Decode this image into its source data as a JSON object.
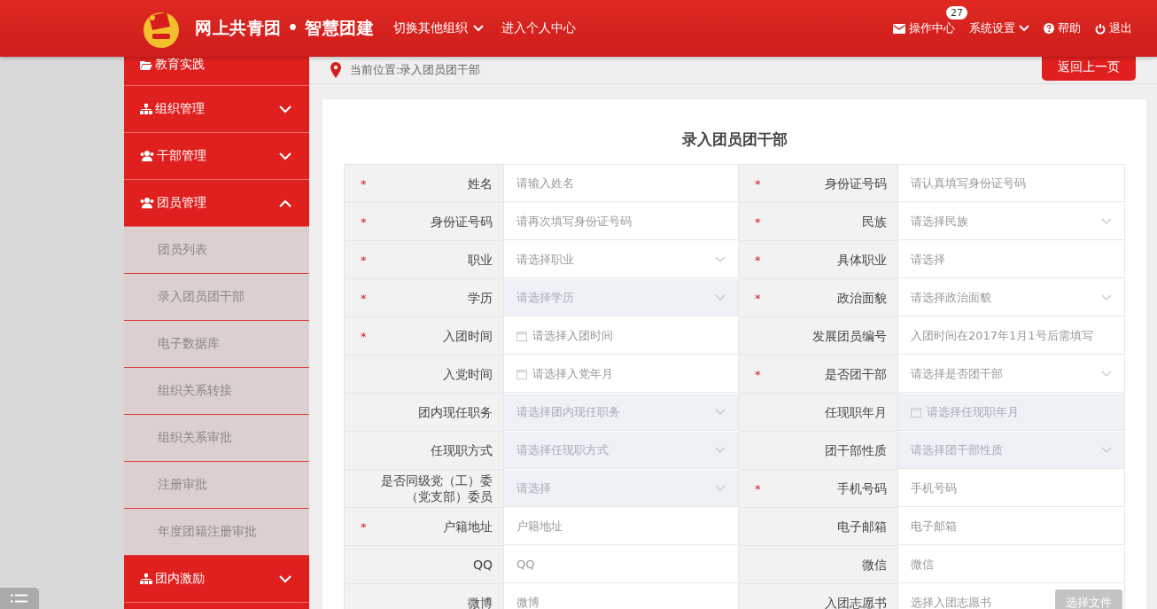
{
  "header": {
    "title": "网上共青团 • 智慧团建",
    "nav": [
      {
        "label": "切换其他组织",
        "dropdown": true
      },
      {
        "label": "进入个人中心",
        "dropdown": false
      }
    ],
    "actions": [
      {
        "kind": "mail",
        "label": "操作中心",
        "badge": "27",
        "dropdown": false
      },
      {
        "kind": "plain",
        "label": "系统设置",
        "dropdown": true
      },
      {
        "kind": "help",
        "label": "帮助",
        "dropdown": false
      },
      {
        "kind": "power",
        "label": "退出",
        "dropdown": false
      }
    ]
  },
  "sidebar": {
    "items": [
      {
        "label": "教育实践"
      },
      {
        "label": "组织管理",
        "expanded": false
      },
      {
        "label": "干部管理",
        "expanded": false
      },
      {
        "label": "团员管理",
        "expanded": true,
        "children": [
          {
            "label": "团员列表"
          },
          {
            "label": "录入团员团干部"
          },
          {
            "label": "电子数据库"
          },
          {
            "label": "组织关系转接"
          },
          {
            "label": "组织关系审批"
          },
          {
            "label": "注册审批"
          },
          {
            "label": "年度团籍注册审批"
          }
        ]
      },
      {
        "label": "团内激励",
        "expanded": false
      }
    ]
  },
  "breadcrumb": "当前位置:录入团员团干部",
  "back_button": "返回上一页",
  "form": {
    "title": "录入团员团干部",
    "rows": [
      [
        {
          "label": "姓名",
          "marker": "*",
          "kind": "text",
          "placeholder": "请输入姓名",
          "disabled": false
        },
        {
          "label": "身份证号码",
          "marker": "*",
          "kind": "text",
          "placeholder": "请认真填写身份证号码",
          "disabled": false
        }
      ],
      [
        {
          "label": "身份证号码",
          "marker": "*",
          "kind": "text",
          "placeholder": "请再次填写身份证号码",
          "disabled": false
        },
        {
          "label": "民族",
          "marker": "*",
          "kind": "select",
          "placeholder": "请选择民族",
          "disabled": false
        }
      ],
      [
        {
          "label": "职业",
          "marker": "*",
          "kind": "select",
          "placeholder": "请选择职业",
          "disabled": false
        },
        {
          "label": "具体职业",
          "marker": "*",
          "kind": "text",
          "placeholder": "请选择",
          "disabled": false
        }
      ],
      [
        {
          "label": "学历",
          "marker": "*",
          "kind": "select",
          "placeholder": "请选择学历",
          "disabled": true
        },
        {
          "label": "政治面貌",
          "marker": "*",
          "kind": "select",
          "placeholder": "请选择政治面貌",
          "disabled": false
        }
      ],
      [
        {
          "label": "入团时间",
          "marker": "*",
          "kind": "date",
          "placeholder": "请选择入团时间",
          "disabled": false
        },
        {
          "label": "发展团员编号",
          "kind": "text",
          "placeholder": "入团时间在2017年1月1号后需填写",
          "disabled": false
        }
      ],
      [
        {
          "label": "入党时间",
          "kind": "date",
          "placeholder": "请选择入党年月",
          "disabled": false
        },
        {
          "label": "是否团干部",
          "marker": "*",
          "kind": "select",
          "placeholder": "请选择是否团干部",
          "disabled": false
        }
      ],
      [
        {
          "label": "团内现任职务",
          "kind": "select",
          "placeholder": "请选择团内现任职务",
          "disabled": true
        },
        {
          "label": "任现职年月",
          "kind": "date",
          "placeholder": "请选择任现职年月",
          "disabled": true
        }
      ],
      [
        {
          "label": "任现职方式",
          "kind": "select",
          "placeholder": "请选择任现职方式",
          "disabled": true
        },
        {
          "label": "团干部性质",
          "kind": "select",
          "placeholder": "请选择团干部性质",
          "disabled": true
        }
      ],
      [
        {
          "label": "是否同级党（工）委（党支部）委员",
          "kind": "select",
          "placeholder": "请选择",
          "disabled": true
        },
        {
          "label": "手机号码",
          "marker": "*",
          "kind": "text",
          "placeholder": "手机号码",
          "disabled": false
        }
      ],
      [
        {
          "label": "户籍地址",
          "marker": "*",
          "kind": "text",
          "placeholder": "户籍地址",
          "disabled": false
        },
        {
          "label": "电子邮箱",
          "kind": "text",
          "placeholder": "电子邮箱",
          "disabled": false
        }
      ],
      [
        {
          "label": "QQ",
          "kind": "text",
          "placeholder": "QQ",
          "disabled": false
        },
        {
          "label": "微信",
          "kind": "text",
          "placeholder": "微信",
          "disabled": false
        }
      ],
      [
        {
          "label": "微博",
          "kind": "text",
          "placeholder": "微博",
          "disabled": false
        },
        {
          "label": "入团志愿书",
          "kind": "file",
          "placeholder": "选择入团志愿书",
          "button": "选择文件",
          "disabled": false
        }
      ]
    ]
  }
}
